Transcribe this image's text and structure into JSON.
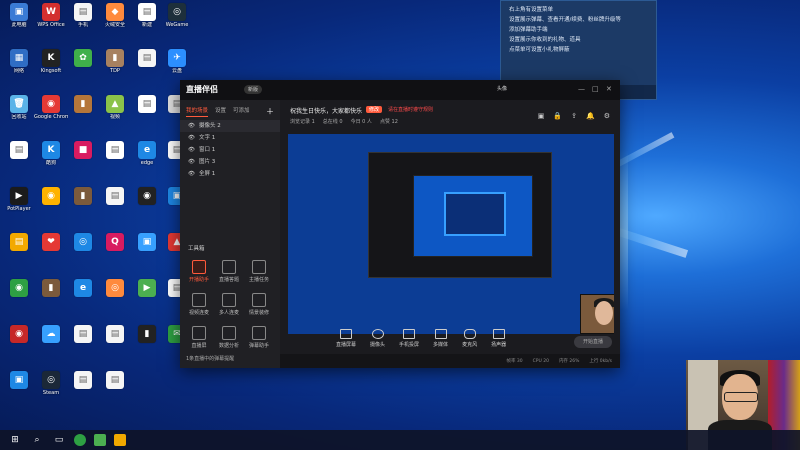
{
  "desktop": {
    "icons": [
      {
        "label": "此电脑",
        "color": "#3a7bd5",
        "glyph": "▣"
      },
      {
        "label": "WPS Office",
        "color": "#d32f2f",
        "glyph": "W"
      },
      {
        "label": "手机",
        "color": "#f5f5f5",
        "glyph": "▤"
      },
      {
        "label": "火绒安全",
        "color": "#ff8a3d",
        "glyph": "◆"
      },
      {
        "label": "新建",
        "color": "#ffffff",
        "glyph": "▤"
      },
      {
        "label": "WeGame",
        "color": "#1d2f3b",
        "glyph": "◎"
      },
      {
        "label": "网络",
        "color": "#2f6dc4",
        "glyph": "▦"
      },
      {
        "label": "Kingsoft",
        "color": "#222",
        "glyph": "K"
      },
      {
        "label": "",
        "color": "#3fb04a",
        "glyph": "✿"
      },
      {
        "label": "TDP",
        "color": "#a78160",
        "glyph": "▮"
      },
      {
        "label": "",
        "color": "#f5f5f5",
        "glyph": "▤"
      },
      {
        "label": "云盘",
        "color": "#2c8fff",
        "glyph": "✈"
      },
      {
        "label": "回收站",
        "color": "#5ab3e8",
        "glyph": "🗑"
      },
      {
        "label": "Google Chrome",
        "color": "#e53935",
        "glyph": "◉"
      },
      {
        "label": "",
        "color": "#b5763a",
        "glyph": "▮"
      },
      {
        "label": "视频",
        "color": "#8bc34a",
        "glyph": "▲"
      },
      {
        "label": "",
        "color": "#ffffff",
        "glyph": "▤"
      },
      {
        "label": "",
        "color": "#e0e0e0",
        "glyph": "▤"
      },
      {
        "label": "",
        "color": "#ffffff",
        "glyph": "▤"
      },
      {
        "label": "酷狗",
        "color": "#1e88e5",
        "glyph": "K"
      },
      {
        "label": "",
        "color": "#d81b60",
        "glyph": "■"
      },
      {
        "label": "",
        "color": "#ffffff",
        "glyph": "▤"
      },
      {
        "label": "edge",
        "color": "#1e88e5",
        "glyph": "e"
      },
      {
        "label": "",
        "color": "#ffffff",
        "glyph": "▤"
      },
      {
        "label": "PotPlayer",
        "color": "#1b1b1b",
        "glyph": "▶"
      },
      {
        "label": "",
        "color": "#ffb300",
        "glyph": "◉"
      },
      {
        "label": "",
        "color": "#7b5a3c",
        "glyph": "▮"
      },
      {
        "label": "",
        "color": "#f5f5f5",
        "glyph": "▤"
      },
      {
        "label": "",
        "color": "#222",
        "glyph": "◉"
      },
      {
        "label": "",
        "color": "#1e88e5",
        "glyph": "▣"
      },
      {
        "label": "",
        "color": "#f2a900",
        "glyph": "▤"
      },
      {
        "label": "",
        "color": "#e53935",
        "glyph": "❤"
      },
      {
        "label": "",
        "color": "#1e88e5",
        "glyph": "◎"
      },
      {
        "label": "",
        "color": "#d81b60",
        "glyph": "Q"
      },
      {
        "label": "",
        "color": "#37a0ff",
        "glyph": "▣"
      },
      {
        "label": "",
        "color": "#e53935",
        "glyph": "▲"
      },
      {
        "label": "",
        "color": "#2ea043",
        "glyph": "◉"
      },
      {
        "label": "",
        "color": "#7b5a3c",
        "glyph": "▮"
      },
      {
        "label": "",
        "color": "#1e88e5",
        "glyph": "e"
      },
      {
        "label": "",
        "color": "#ff8a3d",
        "glyph": "◎"
      },
      {
        "label": "",
        "color": "#4caf50",
        "glyph": "▶"
      },
      {
        "label": "",
        "color": "#ffffff",
        "glyph": "▤"
      },
      {
        "label": "",
        "color": "#c62828",
        "glyph": "◉"
      },
      {
        "label": "",
        "color": "#37a0ff",
        "glyph": "☁"
      },
      {
        "label": "",
        "color": "#f5f5f5",
        "glyph": "▤"
      },
      {
        "label": "",
        "color": "#f5f5f5",
        "glyph": "▤"
      },
      {
        "label": "",
        "color": "#222",
        "glyph": "▮"
      },
      {
        "label": "",
        "color": "#2ea043",
        "glyph": "✉"
      },
      {
        "label": "",
        "color": "#1e88e5",
        "glyph": "▣"
      },
      {
        "label": "Steam",
        "color": "#1b2838",
        "glyph": "◎"
      },
      {
        "label": "",
        "color": "#f5f5f5",
        "glyph": "▤"
      },
      {
        "label": "",
        "color": "#f5f5f5",
        "glyph": "▤"
      }
    ]
  },
  "tooltip": {
    "lines": [
      "右上角有设置菜单",
      "设置展示弹幕、查看开通/续费、粉丝牌升级等",
      "添加弹幕助手端",
      "",
      "设置展示你收到的礼物、道具",
      "点菜单可设置小礼物屏蔽"
    ],
    "controls": [
      "锁定",
      "穿透",
      "设置",
      "开关"
    ]
  },
  "app": {
    "title": "直播伴侣",
    "version": "新版",
    "user_button": "头像",
    "window_controls": [
      "—",
      "□",
      "✕"
    ],
    "left_tabs": [
      "我的场景",
      "设置",
      "可添加"
    ],
    "scenes": [
      "摄像头 2",
      "文字 1",
      "窗口 1",
      "图片 3",
      "全屏 1"
    ],
    "tools_title": "工具箱",
    "tools": [
      "开播助手",
      "直播答题",
      "主播任务",
      "视频连麦",
      "多人连麦",
      "情景装修",
      "直播屏",
      "数据分析",
      "弹幕助手"
    ],
    "left_footer": "1条直播中的弹幕提醒",
    "stream_title": "祝我生日快乐，大家都快乐",
    "stream_badge": "修改",
    "stream_hint": "请在直播时遵守规则",
    "stream_meta": [
      "浏览记录 1",
      "总在线 0",
      "今日 0 人",
      "点赞 12"
    ],
    "bottom_tools": [
      "直播屏幕",
      "摄像头",
      "手机投屏",
      "多媒体",
      "麦克风",
      "扬声器"
    ],
    "start_button": "开始直播",
    "status": [
      "帧率 30",
      "CPU 20",
      "内存 26%",
      "上行 0kb/s"
    ]
  },
  "taskbar": {
    "items": [
      "⊞",
      "⌕",
      "▭"
    ],
    "apps": [
      "#2ea043",
      "#4caf50",
      "#f2a900"
    ]
  }
}
